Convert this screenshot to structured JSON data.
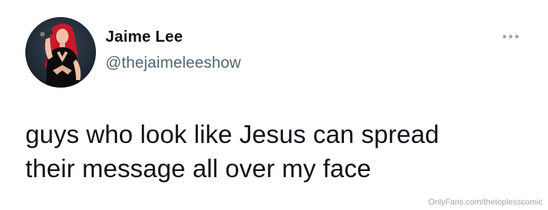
{
  "author": {
    "display_name": "Jaime Lee",
    "handle": "@thejaimeleeshow",
    "avatar_icon": "profile-photo"
  },
  "menu": {
    "icon": "more-horizontal-icon"
  },
  "tweet": {
    "text_lines": [
      "guys who look like Jesus can spread",
      "their message all over my face"
    ]
  },
  "watermark": "OnlyFans.com/thetoplesscomic",
  "colors": {
    "text_primary": "#0f1419",
    "text_secondary": "#536471",
    "background": "#ffffff"
  }
}
